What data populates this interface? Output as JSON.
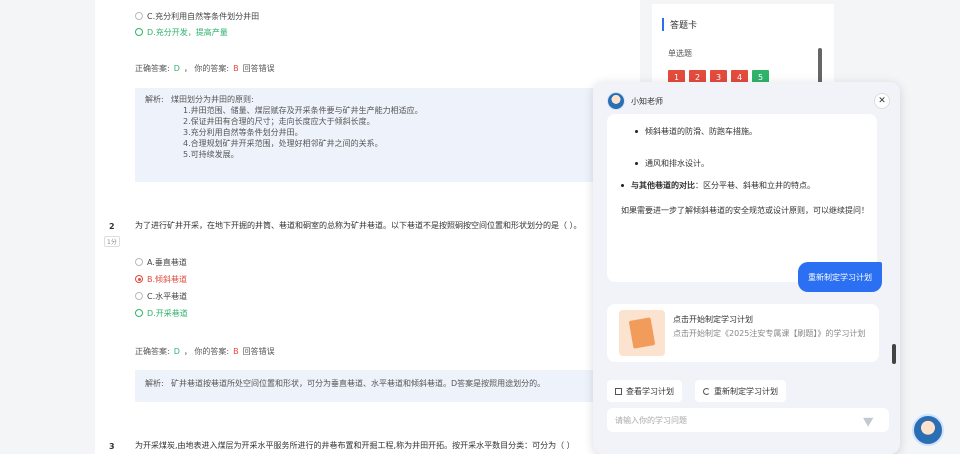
{
  "q1": {
    "opt_c": "C.充分利用自然等条件划分井田",
    "opt_d": "D.充分开发，提高产量",
    "correct_label": "正确答案:",
    "correct": "D",
    "yours_label": "，  你的答案:",
    "yours": "B",
    "result": "回答错误",
    "analysis_label": "解析:",
    "analysis_lines": [
      "煤田划分为井田的原则:",
      "1.井田范围、储量、煤层赋存及开采条件要与矿井生产能力相适应。",
      "2.保证井田有合理的尺寸；走向长度应大于倾斜长度。",
      "3.充分利用自然等条件划分井田。",
      "4.合理规划矿井开采范围，处理好相邻矿井之间的关系。",
      "5.可持续发展。"
    ]
  },
  "q2": {
    "num": "2",
    "score": "1分",
    "text": "为了进行矿井开采，在地下开掘的井筒、巷道和硐室的总称为矿井巷道。以下巷道不是按照硐按空间位置和形状划分的是（    ）。",
    "opt_a": "A.垂直巷道",
    "opt_b": "B.倾斜巷道",
    "opt_c": "C.水平巷道",
    "opt_d": "D.开采巷道",
    "correct_label": "正确答案:",
    "correct": "D",
    "yours_label": "，  你的答案:",
    "yours": "B",
    "result": "回答错误",
    "analysis_label": "解析:",
    "analysis": "矿井巷道按巷道所处空间位置和形状，可分为垂直巷道、水平巷道和倾斜巷道。D答案是按照用途划分的。"
  },
  "q3": {
    "num": "3",
    "text": "为开采煤炭,由地表进入煤层为开采水平服务所进行的井巷布置和开掘工程,称为井田开拓。按开采水平数目分类：可分为（    ）"
  },
  "card": {
    "title": "答题卡",
    "subtitle": "单选题",
    "numbers": [
      "1",
      "2",
      "3",
      "4",
      "5"
    ]
  },
  "chat": {
    "name": "小知老师",
    "close": "✕",
    "bullet_a": "倾斜巷道的防滑、防跑车措施。",
    "bullet_b": "通风和排水设计。",
    "bullet_c_bold": "与其他巷道的对比",
    "bullet_c_rest": "：区分平巷、斜巷和立井的特点。",
    "paragraph": "如果需要进一步了解倾斜巷道的安全规范或设计原则，可以继续提问！",
    "user_message": "重新制定学习计划",
    "plan_title": "点击开始制定学习计划",
    "plan_desc": "点击开始制定《2025注安专属课【刷题】》的学习计划",
    "view_plan": "查看学习计划",
    "replan": "重新制定学习计划",
    "input_placeholder": "请输入你的学习问题"
  },
  "colors": {
    "accent": "#2b6ff3",
    "wrong": "#e34b3d",
    "correct": "#2fb36b"
  }
}
